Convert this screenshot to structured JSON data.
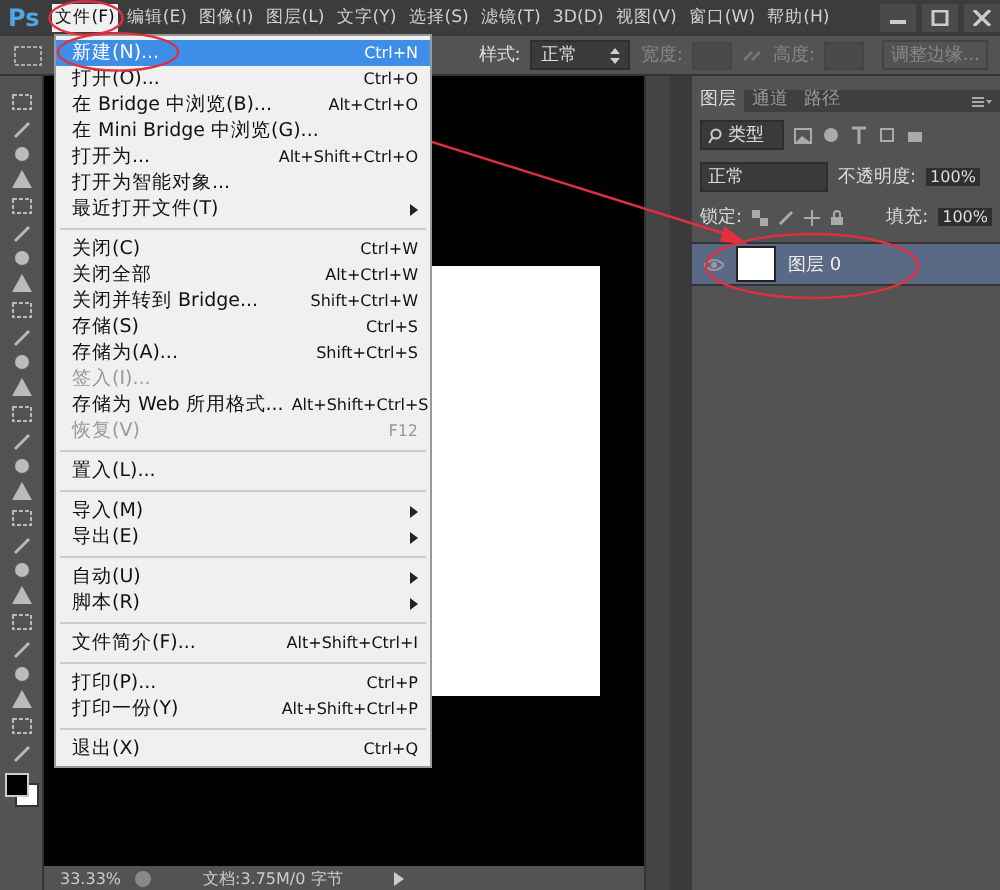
{
  "app": {
    "logo": "Ps"
  },
  "menubar": [
    {
      "label": "文件(F)",
      "selected": true
    },
    {
      "label": "编辑(E)",
      "selected": false
    },
    {
      "label": "图像(I)",
      "selected": false
    },
    {
      "label": "图层(L)",
      "selected": false
    },
    {
      "label": "文字(Y)",
      "selected": false
    },
    {
      "label": "选择(S)",
      "selected": false
    },
    {
      "label": "滤镜(T)",
      "selected": false
    },
    {
      "label": "3D(D)",
      "selected": false
    },
    {
      "label": "视图(V)",
      "selected": false
    },
    {
      "label": "窗口(W)",
      "selected": false
    },
    {
      "label": "帮助(H)",
      "selected": false
    }
  ],
  "options_bar": {
    "style_label": "样式:",
    "style_value": "正常",
    "width_label": "宽度:",
    "height_label": "高度:",
    "refine_button": "调整边缘..."
  },
  "file_menu": [
    {
      "kind": "item",
      "label": "新建(N)...",
      "shortcut": "Ctrl+N",
      "selected": true,
      "disabled": false
    },
    {
      "kind": "item",
      "label": "打开(O)...",
      "shortcut": "Ctrl+O",
      "selected": false,
      "disabled": false
    },
    {
      "kind": "item",
      "label": "在 Bridge 中浏览(B)...",
      "shortcut": "Alt+Ctrl+O",
      "selected": false,
      "disabled": false
    },
    {
      "kind": "item",
      "label": "在 Mini Bridge 中浏览(G)...",
      "selected": false,
      "disabled": false
    },
    {
      "kind": "item",
      "label": "打开为...",
      "shortcut": "Alt+Shift+Ctrl+O",
      "selected": false,
      "disabled": false
    },
    {
      "kind": "item",
      "label": "打开为智能对象...",
      "selected": false,
      "disabled": false
    },
    {
      "kind": "submenu",
      "label": "最近打开文件(T)",
      "selected": false,
      "disabled": false
    },
    {
      "kind": "separator"
    },
    {
      "kind": "item",
      "label": "关闭(C)",
      "shortcut": "Ctrl+W",
      "selected": false,
      "disabled": false
    },
    {
      "kind": "item",
      "label": "关闭全部",
      "shortcut": "Alt+Ctrl+W",
      "selected": false,
      "disabled": false
    },
    {
      "kind": "item",
      "label": "关闭并转到 Bridge...",
      "shortcut": "Shift+Ctrl+W",
      "selected": false,
      "disabled": false
    },
    {
      "kind": "item",
      "label": "存储(S)",
      "shortcut": "Ctrl+S",
      "selected": false,
      "disabled": false
    },
    {
      "kind": "item",
      "label": "存储为(A)...",
      "shortcut": "Shift+Ctrl+S",
      "selected": false,
      "disabled": false
    },
    {
      "kind": "item",
      "label": "签入(I)...",
      "selected": false,
      "disabled": true
    },
    {
      "kind": "item",
      "label": "存储为 Web 所用格式...",
      "shortcut": "Alt+Shift+Ctrl+S",
      "selected": false,
      "disabled": false
    },
    {
      "kind": "item",
      "label": "恢复(V)",
      "shortcut": "F12",
      "selected": false,
      "disabled": true
    },
    {
      "kind": "separator"
    },
    {
      "kind": "item",
      "label": "置入(L)...",
      "selected": false,
      "disabled": false
    },
    {
      "kind": "separator"
    },
    {
      "kind": "submenu",
      "label": "导入(M)",
      "selected": false,
      "disabled": false
    },
    {
      "kind": "submenu",
      "label": "导出(E)",
      "selected": false,
      "disabled": false
    },
    {
      "kind": "separator"
    },
    {
      "kind": "submenu",
      "label": "自动(U)",
      "selected": false,
      "disabled": false
    },
    {
      "kind": "submenu",
      "label": "脚本(R)",
      "selected": false,
      "disabled": false
    },
    {
      "kind": "separator"
    },
    {
      "kind": "item",
      "label": "文件简介(F)...",
      "shortcut": "Alt+Shift+Ctrl+I",
      "selected": false,
      "disabled": false
    },
    {
      "kind": "separator"
    },
    {
      "kind": "item",
      "label": "打印(P)...",
      "shortcut": "Ctrl+P",
      "selected": false,
      "disabled": false
    },
    {
      "kind": "item",
      "label": "打印一份(Y)",
      "shortcut": "Alt+Shift+Ctrl+P",
      "selected": false,
      "disabled": false
    },
    {
      "kind": "separator"
    },
    {
      "kind": "item",
      "label": "退出(X)",
      "shortcut": "Ctrl+Q",
      "selected": false,
      "disabled": false
    }
  ],
  "layers_panel": {
    "tabs": [
      {
        "label": "图层",
        "selected": true
      },
      {
        "label": "通道",
        "selected": false
      },
      {
        "label": "路径",
        "selected": false
      }
    ],
    "filter_label": "类型",
    "blend_mode": "正常",
    "opacity_label": "不透明度:",
    "opacity_value": "100%",
    "lock_label": "锁定:",
    "fill_label": "填充:",
    "fill_value": "100%",
    "layers": [
      {
        "name": "图层 0",
        "selected": true
      }
    ]
  },
  "status_bar": {
    "zoom": "33.33%",
    "doc_info": "文档:3.75M/0 字节"
  }
}
